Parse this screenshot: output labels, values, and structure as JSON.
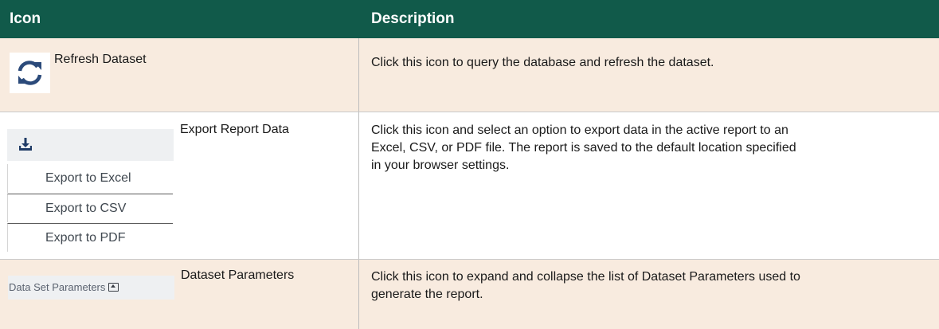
{
  "table": {
    "header": {
      "icon": "Icon",
      "description": "Description"
    },
    "rows": [
      {
        "icon_name": "refresh-icon",
        "label": "Refresh Dataset",
        "description": "Click this icon to query the database and refresh the dataset."
      },
      {
        "icon_name": "download-icon",
        "label": "Export Report Data",
        "menu_items": [
          "Export to Excel",
          "Export to CSV",
          "Export to PDF"
        ],
        "description_lines": [
          "Click this icon and select an option to export data in the active report to an",
          "Excel, CSV, or PDF file. The report is saved to the default location specified",
          "in your browser settings."
        ]
      },
      {
        "icon_name": "collapse-toggle-icon",
        "widget_label": "Data Set Parameters",
        "label": "Dataset Parameters",
        "description_lines": [
          "Click this icon to expand and collapse the list of Dataset Parameters used to",
          "generate the report."
        ]
      }
    ]
  },
  "colors": {
    "header_bg": "#115a4a",
    "header_text": "#ffffff",
    "row_highlight": "#f8ebdf",
    "refresh_blue": "#2b4a7a"
  }
}
